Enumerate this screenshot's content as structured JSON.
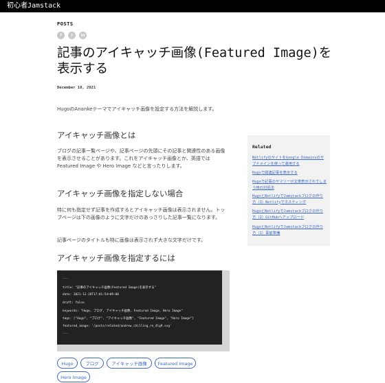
{
  "site": {
    "title": "初心者Jamstack"
  },
  "section": {
    "label": "POSTS"
  },
  "share": {
    "facebook": "f",
    "twitter": "t",
    "linkedin": "in"
  },
  "post": {
    "title": "記事のアイキャッチ画像(Featured Image)を表示する",
    "date": "December 18, 2021",
    "intro": "HugoのAnankeテーマでアイキャッチ画像を設定する方法を解説します。",
    "h_about": "アイキャッチ画像とは",
    "p_about": "ブログの記事一覧ページや、記事ページの先頭にその記事と関連性のある画像を表示させることがあります。これをアイキャッチ画像とか、英語では Featured Image や Hero Image などと言ったりします。",
    "h_none": "アイキャッチ画像を指定しない場合",
    "p_none_1": "特に何も指定せず記事を作成するとアイキャッチ画像は表示されません。トップページは下の画像のように文字だけのあっさりした記事一覧になります。",
    "p_none_2": "記事ページのタイトルも特に画像は表示されず大きな文字だけです。",
    "h_set": "アイキャッチ画像を指定するには",
    "code": [
      "---",
      "title: \"記事のアイキャッチ画像(Featured Image)を表示する\"",
      "date: 2021-12-18T17:01:54+09:00",
      "draft: false",
      "keywords: \"Hugo, ブログ, アイキャッチ画像, Featured Image, Hero Image\"",
      "tags: [\"Hugo\", \"ブログ\", \"アイキャッチ画像\", \"Featured Image\", \"Hero Image\"]",
      "featured_image: '/posts/related/andrew_chilling_re_4lg9.svg'",
      "---"
    ],
    "tags": [
      "Hugo",
      "ブログ",
      "アイキャッチ画像",
      "Featured Image",
      "Hero Image"
    ]
  },
  "sidebar": {
    "heading": "Related",
    "links": [
      "NetlifyのサイトをGoogle Domainsのサブドメインを使って運用する",
      "Hugoで関連記事を表示する",
      "Hugoで記事のサマリーが文章表示されてしまう時の対処法",
      "HugoとNetlifyでJamstackブログの作り方（3）Netlifyでホスティング",
      "HugoとNetlifyでJamstackブログの作り方（2）GitHubへアップロード",
      "HugoとNetlifyでJamstackブログの作り方（1）事前準備"
    ]
  }
}
